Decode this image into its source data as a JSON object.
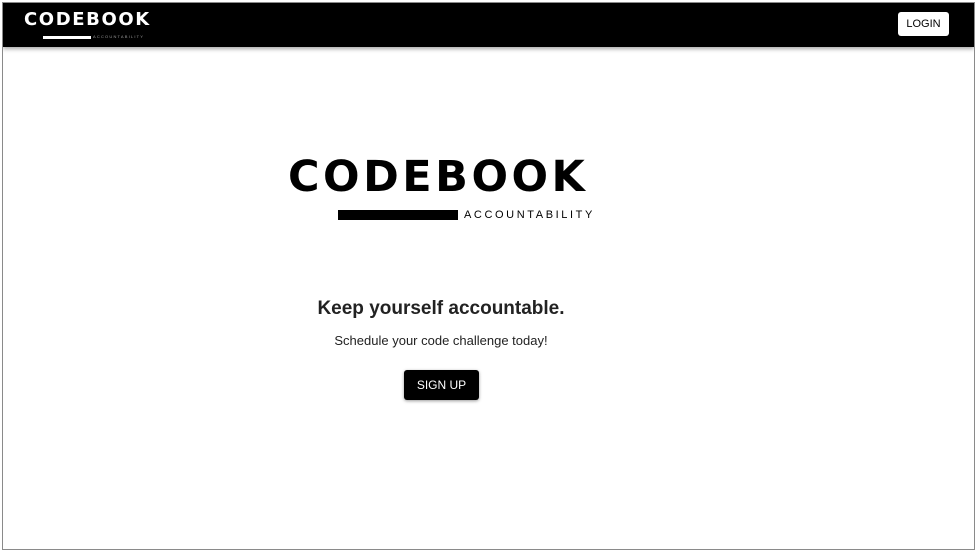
{
  "navbar": {
    "logo": {
      "wordmark": "CODEBOOK",
      "tagline": "ACCOUNTABILITY"
    },
    "login_label": "LOGIN"
  },
  "hero": {
    "logo": {
      "wordmark": "CODEBOOK",
      "tagline": "ACCOUNTABILITY"
    },
    "headline": "Keep yourself accountable.",
    "subheadline": "Schedule your code challenge today!",
    "signup_label": "SIGN UP"
  },
  "colors": {
    "navbar_background": "#000000",
    "primary_button": "#000000",
    "text": "#222222",
    "page_background": "#ffffff"
  }
}
